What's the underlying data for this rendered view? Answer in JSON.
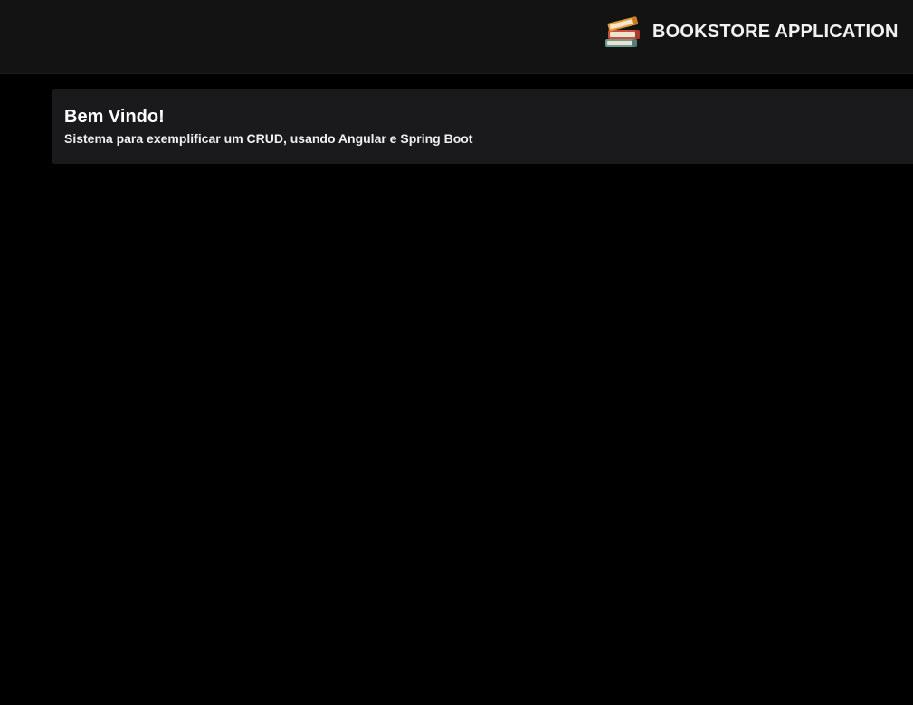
{
  "header": {
    "app_title": "BOOKSTORE APPLICATION",
    "logo_icon": "books-stack-icon"
  },
  "welcome_card": {
    "title": "Bem Vindo!",
    "subtitle": "Sistema para exemplificar um CRUD, usando Angular e Spring Boot"
  },
  "colors": {
    "background": "#000000",
    "toolbar": "#131313",
    "card": "#1a191b",
    "text": "#ffffff"
  }
}
